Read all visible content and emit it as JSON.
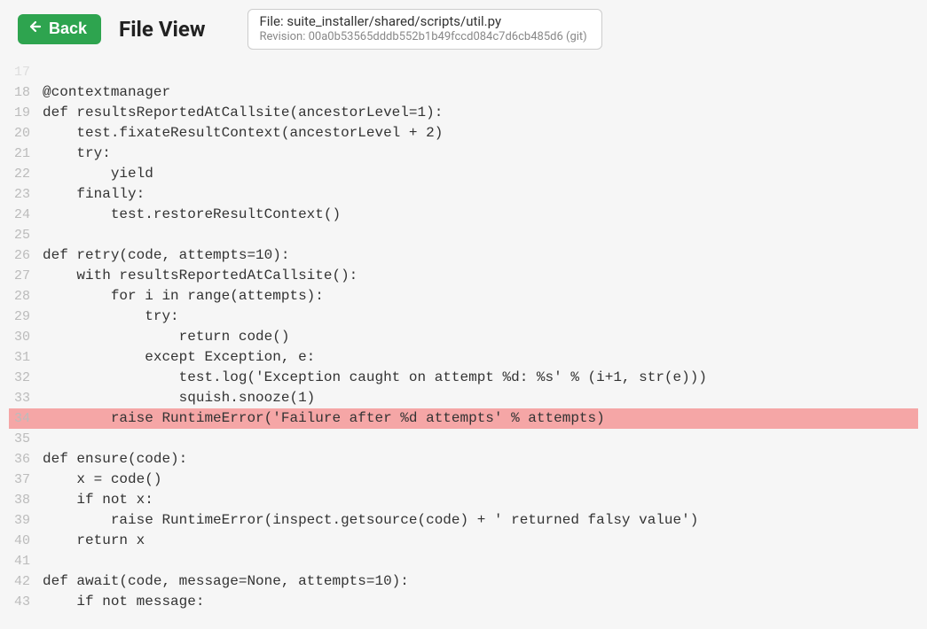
{
  "header": {
    "back_label": "Back",
    "title": "File View",
    "file_label": "File: ",
    "file_path": "suite_installer/shared/scripts/util.py",
    "revision_label": "Revision: ",
    "revision_value": "00a0b53565dddb552b1b49fccd084c7d6cb485d6 (git)"
  },
  "highlight_line": 34,
  "lines": [
    {
      "n": 17,
      "t": "",
      "cut": true
    },
    {
      "n": 18,
      "t": "@contextmanager"
    },
    {
      "n": 19,
      "t": "def resultsReportedAtCallsite(ancestorLevel=1):"
    },
    {
      "n": 20,
      "t": "    test.fixateResultContext(ancestorLevel + 2)"
    },
    {
      "n": 21,
      "t": "    try:"
    },
    {
      "n": 22,
      "t": "        yield"
    },
    {
      "n": 23,
      "t": "    finally:"
    },
    {
      "n": 24,
      "t": "        test.restoreResultContext()"
    },
    {
      "n": 25,
      "t": ""
    },
    {
      "n": 26,
      "t": "def retry(code, attempts=10):"
    },
    {
      "n": 27,
      "t": "    with resultsReportedAtCallsite():"
    },
    {
      "n": 28,
      "t": "        for i in range(attempts):"
    },
    {
      "n": 29,
      "t": "            try:"
    },
    {
      "n": 30,
      "t": "                return code()"
    },
    {
      "n": 31,
      "t": "            except Exception, e:"
    },
    {
      "n": 32,
      "t": "                test.log('Exception caught on attempt %d: %s' % (i+1, str(e)))"
    },
    {
      "n": 33,
      "t": "                squish.snooze(1)"
    },
    {
      "n": 34,
      "t": "        raise RuntimeError('Failure after %d attempts' % attempts)"
    },
    {
      "n": 35,
      "t": ""
    },
    {
      "n": 36,
      "t": "def ensure(code):"
    },
    {
      "n": 37,
      "t": "    x = code()"
    },
    {
      "n": 38,
      "t": "    if not x:"
    },
    {
      "n": 39,
      "t": "        raise RuntimeError(inspect.getsource(code) + ' returned falsy value')"
    },
    {
      "n": 40,
      "t": "    return x"
    },
    {
      "n": 41,
      "t": ""
    },
    {
      "n": 42,
      "t": "def await(code, message=None, attempts=10):"
    },
    {
      "n": 43,
      "t": "    if not message:"
    }
  ]
}
